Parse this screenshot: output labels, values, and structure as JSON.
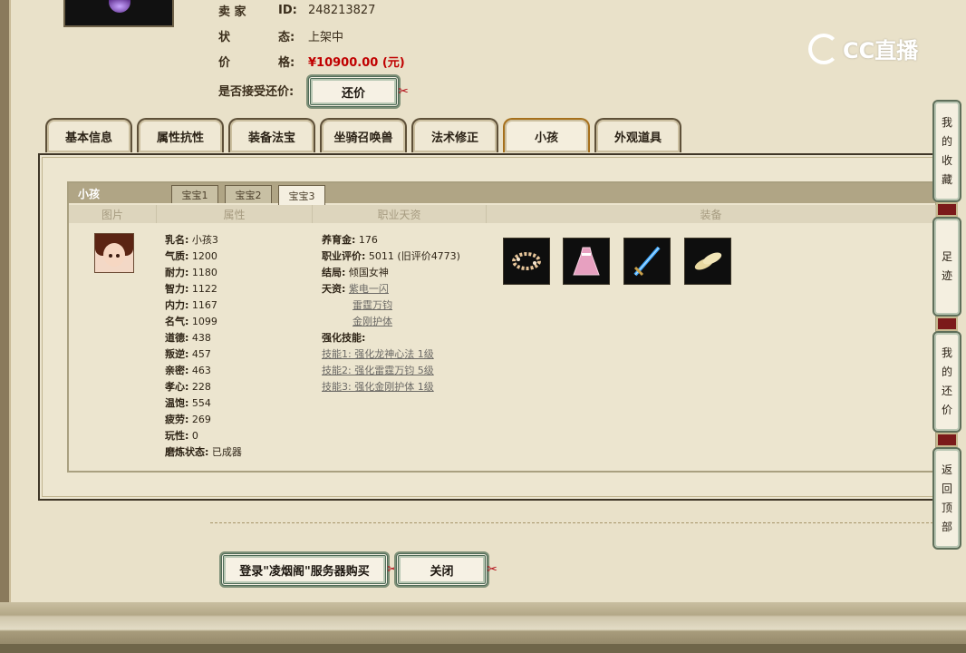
{
  "seller": {
    "label_seller": "卖 家",
    "label_id": "ID:",
    "id": "248213827",
    "label_status": "状",
    "label_status2": "态:",
    "status": "上架中",
    "label_price": "价",
    "label_price2": "格:",
    "price": "¥10900.00 (元)",
    "label_counter": "是否接受还价:",
    "counter_button": "还价"
  },
  "logo": {
    "text": "CC直播"
  },
  "tabs": [
    {
      "label": "基本信息"
    },
    {
      "label": "属性抗性"
    },
    {
      "label": "装备法宝"
    },
    {
      "label": "坐骑召唤兽"
    },
    {
      "label": "法术修正"
    },
    {
      "label": "小孩"
    },
    {
      "label": "外观道具"
    }
  ],
  "child": {
    "title": "小孩",
    "subtabs": [
      "宝宝1",
      "宝宝2",
      "宝宝3"
    ],
    "columns": [
      "图片",
      "属性",
      "职业天资",
      "装备"
    ],
    "attrs": [
      {
        "k": "乳名:",
        "v": "小孩3"
      },
      {
        "k": "气质:",
        "v": "1200"
      },
      {
        "k": "耐力:",
        "v": "1180"
      },
      {
        "k": "智力:",
        "v": "1122"
      },
      {
        "k": "内力:",
        "v": "1167"
      },
      {
        "k": "名气:",
        "v": "1099"
      },
      {
        "k": "道德:",
        "v": "438"
      },
      {
        "k": "叛逆:",
        "v": "457"
      },
      {
        "k": "亲密:",
        "v": "463"
      },
      {
        "k": "孝心:",
        "v": "228"
      },
      {
        "k": "温饱:",
        "v": "554"
      },
      {
        "k": "疲劳:",
        "v": "269"
      },
      {
        "k": "玩性:",
        "v": "0"
      },
      {
        "k": "磨炼状态:",
        "v": "已成器"
      }
    ],
    "talent": {
      "gold_k": "养育金:",
      "gold_v": "176",
      "eval_k": "职业评价:",
      "eval_v": "5011 (旧评价4773)",
      "ending_k": "结局:",
      "ending_v": "倾国女神",
      "talent_k": "天资:",
      "talents": [
        "紫电一闪",
        "雷霆万钧",
        "金刚护体"
      ],
      "skills_k": "强化技能:",
      "skills": [
        "技能1: 强化龙神心法 1级",
        "技能2: 强化雷霆万钧 5级",
        "技能3: 强化金刚护体 1级"
      ]
    },
    "equipment_icons": [
      "wreath-icon",
      "pink-dress-icon",
      "blue-sword-icon",
      "shoes-icon"
    ]
  },
  "buttons": {
    "login_buy": "登录\"凌烟阁\"服务器购买",
    "close": "关闭"
  },
  "sidebar": [
    {
      "label": [
        "我",
        "的",
        "收",
        "藏"
      ]
    },
    {
      "label": [
        "足",
        "迹"
      ]
    },
    {
      "label": [
        "我",
        "的",
        "还",
        "价"
      ]
    },
    {
      "label": [
        "返",
        "回",
        "顶",
        "部"
      ]
    }
  ]
}
